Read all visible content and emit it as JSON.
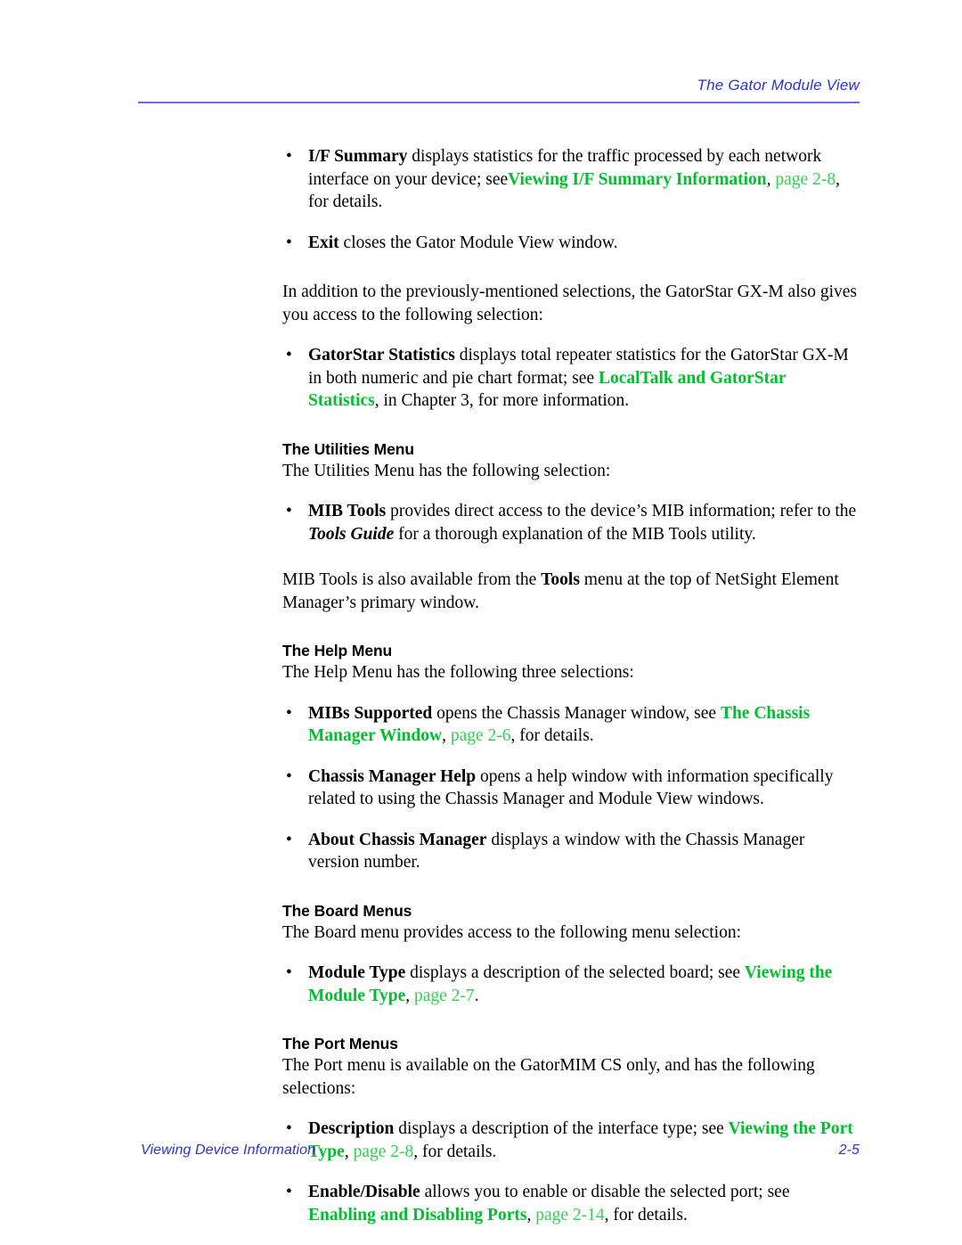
{
  "header": {
    "title": "The Gator Module View"
  },
  "colors": {
    "header_blue": "#2B32D8",
    "rule_blue": "#6B6FD8",
    "link_green": "#00C12B",
    "page_ref_green": "#33D14D",
    "body_black": "#000000"
  },
  "bullet_glyph": "•",
  "body": {
    "bullet_if_summary": {
      "term": "I/F Summary",
      "text1": " displays statistics for the traffic processed by each network interface on your device; see",
      "link": "Viewing I/F Summary Information",
      "comma1": ", ",
      "page_ref": "page 2-8",
      "text2": ", for details."
    },
    "bullet_exit": {
      "term": "Exit",
      "text1": " closes the Gator Module View window."
    },
    "para_addition": "In addition to the previously-mentioned selections, the GatorStar GX-M also gives you access to the following selection:",
    "bullet_gatorstar_statistics": {
      "term": "GatorStar Statistics",
      "text1": " displays total repeater statistics for the GatorStar GX-M in both numeric and pie chart format; see ",
      "link": "LocalTalk and GatorStar Statistics",
      "text2": ", in Chapter 3, for more information."
    },
    "heading_utilities": "The Utilities Menu",
    "para_utilities_intro": "The Utilities Menu has the following selection:",
    "bullet_mib_tools": {
      "term": "MIB Tools",
      "text1": " provides direct access to the device’s MIB information; refer to the ",
      "italic_term": "Tools Guide",
      "text2": " for a thorough explanation of the MIB Tools utility."
    },
    "para_mib_tools_avail": {
      "text1": "MIB Tools is also available from the ",
      "bold_term": "Tools",
      "text2": " menu at the top of NetSight Element Manager’s primary window."
    },
    "heading_help": "The Help Menu",
    "para_help_intro": "The Help Menu has the following three selections:",
    "bullet_mibs_supported": {
      "term": "MIBs Supported",
      "text1": " opens the Chassis Manager window, see ",
      "link": "The Chassis Manager Window",
      "comma1": ", ",
      "page_ref": "page 2-6",
      "text2": ", for details."
    },
    "bullet_chassis_manager_help": {
      "term": "Chassis Manager Help",
      "text1": " opens a help window with information specifically related to using the Chassis Manager and Module View windows."
    },
    "bullet_about_chassis_manager": {
      "term": "About Chassis Manager",
      "text1": " displays a window with the Chassis Manager version number."
    },
    "heading_board": "The Board Menus",
    "para_board_intro": "The Board menu provides access to the following menu selection:",
    "bullet_module_type": {
      "term": "Module Type",
      "text1": " displays a description of the selected board; see ",
      "link": "Viewing the Module Type",
      "comma1": ", ",
      "page_ref": "page 2-7",
      "text2": "."
    },
    "heading_port": "The Port Menus",
    "para_port_intro": "The Port menu is available on the GatorMIM CS only, and has the following selections:",
    "bullet_description": {
      "term": "Description",
      "text1": " displays a description of the interface type; see ",
      "link": "Viewing the Port Type",
      "comma1": ", ",
      "page_ref": "page 2-8",
      "text2": ", for details."
    },
    "bullet_enable_disable": {
      "term": "Enable/Disable",
      "text1": " allows you to enable or disable the selected port; see ",
      "link": "Enabling and Disabling Ports",
      "comma1": ", ",
      "page_ref": "page 2-14",
      "text2": ", for details."
    }
  },
  "footer": {
    "text": "Viewing Device Information",
    "page_number": "2-5"
  }
}
